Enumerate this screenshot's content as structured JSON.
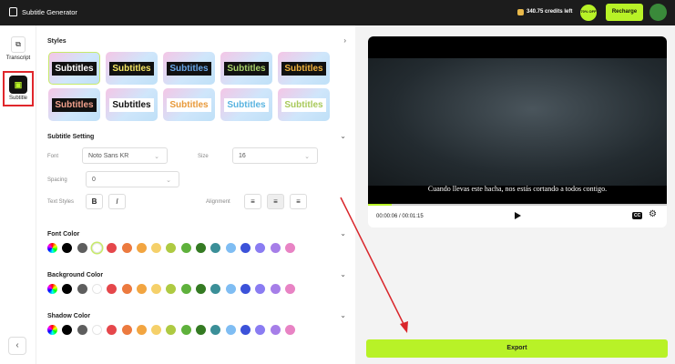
{
  "header": {
    "title": "Subtitle Generator",
    "credits": "340.75 credits left",
    "badge": "70% OFF",
    "recharge": "Recharge"
  },
  "rail": {
    "items": [
      {
        "label": "Transcript"
      },
      {
        "label": "Subtitle",
        "active": true
      }
    ]
  },
  "styles": {
    "title": "Styles",
    "tiles": [
      {
        "text": "Subtitles",
        "color": "#ffffff",
        "bg": "#111111",
        "selected": true
      },
      {
        "text": "Subtitles",
        "color": "#f5e663",
        "bg": "#111111"
      },
      {
        "text": "Subtitles",
        "color": "#6aa7e8",
        "bg": "#111111"
      },
      {
        "text": "Subtitles",
        "color": "#a9d36b",
        "bg": "#111111"
      },
      {
        "text": "Subtitles",
        "color": "#f0b23d",
        "bg": "#111111"
      },
      {
        "text": "Subtitles",
        "color": "#f2a08c",
        "bg": "#111111"
      },
      {
        "text": "Subtitles",
        "color": "#111111",
        "bg": "#ffffff"
      },
      {
        "text": "Subtitles",
        "color": "#e8993a",
        "bg": "#ffffff"
      },
      {
        "text": "Subtitles",
        "color": "#58b3e0",
        "bg": "#ffffff"
      },
      {
        "text": "Subtitles",
        "color": "#a8c95a",
        "bg": "#ffffff"
      }
    ]
  },
  "settings": {
    "title": "Subtitle Setting",
    "font_label": "Font",
    "font_value": "Noto Sans KR",
    "size_label": "Size",
    "size_value": "16",
    "spacing_label": "Spacing",
    "spacing_value": "0",
    "text_styles_label": "Text Styles",
    "bold": "B",
    "italic": "I",
    "alignment_label": "Alignment",
    "alignment_selected": "center"
  },
  "colors": {
    "palette": [
      "#000000",
      "#5e5e5e",
      "#ffffff",
      "#e5474b",
      "#ec7a3f",
      "#f2a541",
      "#f5d06a",
      "#aeca42",
      "#5fb13c",
      "#347a22",
      "#3b8f98",
      "#7fbdf3",
      "#3c52d9",
      "#8a7cf2",
      "#a67ee8",
      "#e883c4"
    ],
    "sections": [
      {
        "title": "Font Color",
        "selected": "#ffffff"
      },
      {
        "title": "Background Color"
      },
      {
        "title": "Shadow Color"
      }
    ]
  },
  "player": {
    "subtitle": "Cuando llevas este hacha, nos estás cortando a todos contigo.",
    "time": "00:00:06 / 00:01:15",
    "progress": 0.08,
    "cc": "CC"
  },
  "export": "Export",
  "accent": "#b8f227"
}
